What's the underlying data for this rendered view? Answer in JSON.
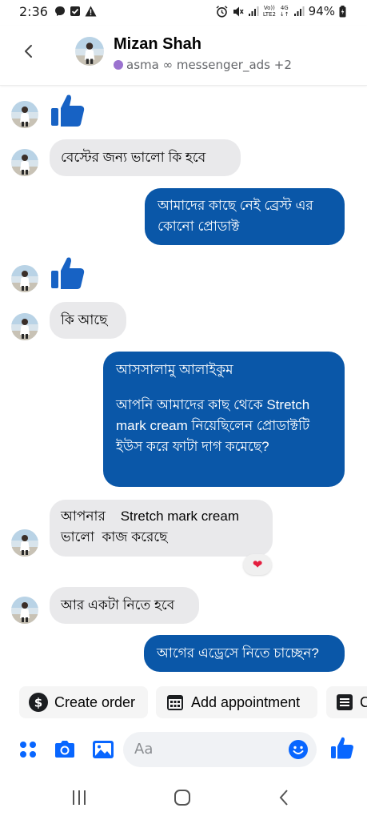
{
  "status_bar": {
    "time": "2:36",
    "battery": "94%",
    "network_top": "Vo))",
    "network_bottom": "LTE2",
    "data_top": "4G",
    "data_bottom": "↓↑"
  },
  "header": {
    "name": "Mizan Shah",
    "labels": "asma ∞ messenger_ads +2"
  },
  "messages": [
    {
      "id": "m1",
      "from": "contact",
      "type": "like"
    },
    {
      "id": "m2",
      "from": "contact",
      "text": "বেস্টের জন্য  ভালো  কি হবে"
    },
    {
      "id": "m3",
      "from": "me",
      "text": "আমাদের কাছে নেই ব্রেস্ট এর কোনো প্রোডাক্ট"
    },
    {
      "id": "m4",
      "from": "contact",
      "type": "like"
    },
    {
      "id": "m5",
      "from": "contact",
      "text": "কি আছে"
    },
    {
      "id": "m6",
      "from": "me",
      "line1": "আসসালামু আলাইকুম",
      "line2": "আপনি আমাদের কাছ থেকে Stretch mark cream নিয়েছিলেন প্রোডাক্টটি ইউস করে ফাটা দাগ কমেছে?"
    },
    {
      "id": "m7",
      "from": "contact",
      "text": "আপনার    Stretch mark cream ভালো  কাজ করেছে",
      "reaction": "❤"
    },
    {
      "id": "m8",
      "from": "contact",
      "text": "আর একটা নিতে হবে"
    },
    {
      "id": "m9",
      "from": "me",
      "text": "আগের এড্রেসে নিতে চাচ্ছেন?"
    }
  ],
  "quick_actions": {
    "create_order": "Create order",
    "add_appointment": "Add appointment",
    "third_partial": "C"
  },
  "composer": {
    "placeholder": "Aa"
  },
  "colors": {
    "outgoing_bubble": "#0a57a8",
    "incoming_bubble": "#e9e9eb",
    "messenger_blue": "#0866ff",
    "like_blue": "#1762c4"
  }
}
